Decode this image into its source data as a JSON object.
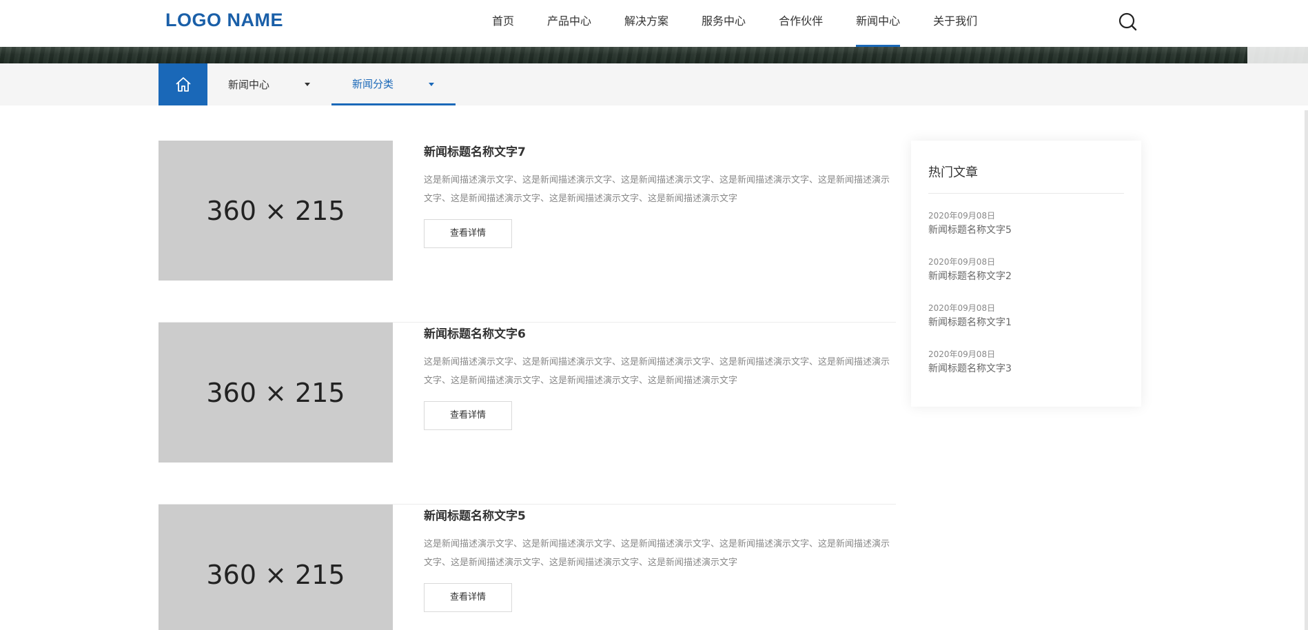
{
  "header": {
    "logo": "LOGO NAME",
    "nav": [
      "首页",
      "产品中心",
      "解决方案",
      "服务中心",
      "合作伙伴",
      "新闻中心",
      "关于我们"
    ],
    "active_nav": "新闻中心",
    "search_icon": "search-icon"
  },
  "subnav": {
    "home_icon": "home-icon",
    "crumb_1": "新闻中心",
    "crumb_2": "新闻分类"
  },
  "articles": [
    {
      "thumb": "360 × 215",
      "title": "新闻标题名称文字7",
      "desc": "这是新闻描述演示文字、这是新闻描述演示文字、这是新闻描述演示文字、这是新闻描述演示文字、这是新闻描述演示文字、这是新闻描述演示文字、这是新闻描述演示文字、这是新闻描述演示文字",
      "button": "查看详情"
    },
    {
      "thumb": "360 × 215",
      "title": "新闻标题名称文字6",
      "desc": "这是新闻描述演示文字、这是新闻描述演示文字、这是新闻描述演示文字、这是新闻描述演示文字、这是新闻描述演示文字、这是新闻描述演示文字、这是新闻描述演示文字、这是新闻描述演示文字",
      "button": "查看详情"
    },
    {
      "thumb": "360 × 215",
      "title": "新闻标题名称文字5",
      "desc": "这是新闻描述演示文字、这是新闻描述演示文字、这是新闻描述演示文字、这是新闻描述演示文字、这是新闻描述演示文字、这是新闻描述演示文字、这是新闻描述演示文字、这是新闻描述演示文字",
      "button": "查看详情"
    }
  ],
  "sidebar": {
    "title": "热门文章",
    "items": [
      {
        "date": "2020年09月08日",
        "title": "新闻标题名称文字5"
      },
      {
        "date": "2020年09月08日",
        "title": "新闻标题名称文字2"
      },
      {
        "date": "2020年09月08日",
        "title": "新闻标题名称文字1"
      },
      {
        "date": "2020年09月08日",
        "title": "新闻标题名称文字3"
      }
    ]
  },
  "colors": {
    "brand": "#1a68b8",
    "logo": "#1a5fa8",
    "placeholder": "#cccccc"
  }
}
